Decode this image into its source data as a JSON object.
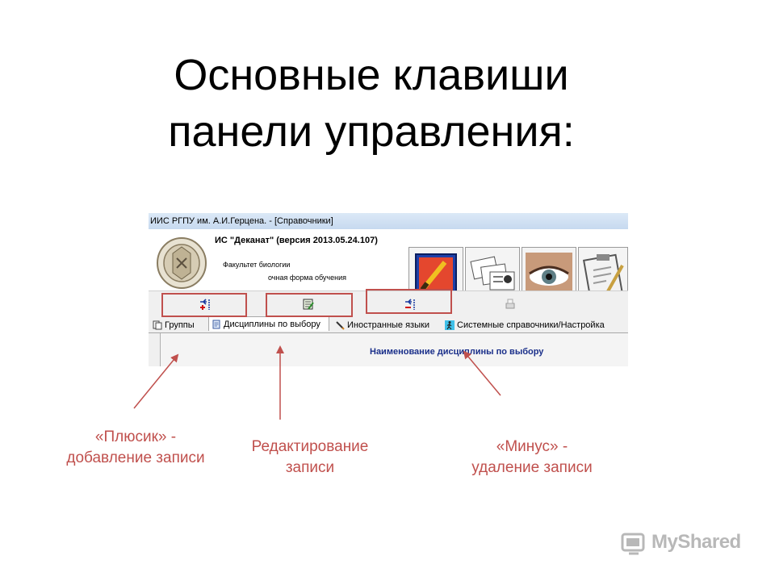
{
  "slide": {
    "title_line1": "Основные клавиши",
    "title_line2": "панели управления:"
  },
  "window": {
    "title": "ИИС РГПУ им. А.И.Герцена.  - [Справочники]",
    "app_name": "ИС \"Деканат\" (версия 2013.05.24.107)",
    "faculty": "Факультет биологии",
    "study_form": "очная форма обучения"
  },
  "toolbar": {
    "add_icon": "add-record-icon",
    "edit_icon": "edit-record-icon",
    "delete_icon": "delete-record-icon",
    "print_icon": "print-icon"
  },
  "tabs": [
    {
      "label": "Группы",
      "icon": "groups-icon"
    },
    {
      "label": "Дисциплины по выбору",
      "icon": "document-icon"
    },
    {
      "label": "Иностранные языки",
      "icon": "pencil-icon"
    },
    {
      "label": "Системные справочники/Настройка",
      "icon": "walking-man-icon"
    }
  ],
  "grid": {
    "column_header": "Наименование дисциплины по выбору"
  },
  "captions": {
    "plus_line1": "«Плюсик» -",
    "plus_line2": "добавление записи",
    "edit_line1": "Редактирование",
    "edit_line2": "записи",
    "minus_line1": "«Минус» -",
    "minus_line2": "удаление записи"
  },
  "watermark": {
    "text": "MyShared"
  },
  "colors": {
    "accent_red": "#c0504d",
    "header_blue": "#1a2f8a"
  }
}
